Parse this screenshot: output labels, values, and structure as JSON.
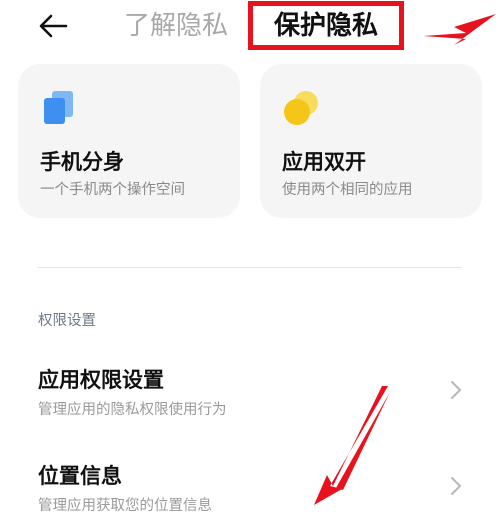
{
  "header": {
    "tabs": [
      {
        "label": "了解隐私",
        "active": false
      },
      {
        "label": "保护隐私",
        "active": true
      }
    ]
  },
  "features": [
    {
      "icon": "dual-squares-icon",
      "title": "手机分身",
      "subtitle": "一个手机两个操作空间",
      "icon_color": "#4d9cf0"
    },
    {
      "icon": "dual-circles-icon",
      "title": "应用双开",
      "subtitle": "使用两个相同的应用",
      "icon_color": "#f5cc1b"
    }
  ],
  "permissions": {
    "section_title": "权限设置",
    "items": [
      {
        "title": "应用权限设置",
        "subtitle": "管理应用的隐私权限使用行为"
      },
      {
        "title": "位置信息",
        "subtitle": "管理应用获取您的位置信息"
      }
    ]
  },
  "colors": {
    "annotation_red": "#e8121f",
    "card_background": "#f5f5f5"
  }
}
